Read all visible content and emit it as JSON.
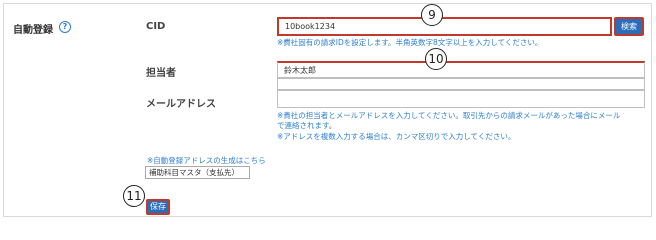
{
  "section": {
    "label": "自動登録"
  },
  "cid": {
    "label": "CID",
    "value": "10book1234",
    "search_label": "検索",
    "note": "※費社固有の請求IDを設定します。半角英数字8文字以上を入力してください。"
  },
  "contact": {
    "person_label": "担当者",
    "person_value": "鈴木太郎",
    "email_label": "メールアドレス",
    "email_value": "",
    "note1": "※貴社の担当者とメールアドレスを入力してください。取引先からの請求メールがあった場合にメール",
    "note2": "で連絡されます。",
    "note3": "※アドレスを複数入力する場合は、カンマ区切りで入力してください。"
  },
  "auto_link": "※自動登録アドレスの生成はこちら",
  "select_value": "補助科目マスタ（支払先）",
  "save_label": "保存",
  "badges": {
    "b9": "9",
    "b10": "10",
    "b11": "11"
  },
  "colors": {
    "accent": "#2a6ebb",
    "highlight": "#c0392b",
    "note": "#2f7fd1"
  }
}
